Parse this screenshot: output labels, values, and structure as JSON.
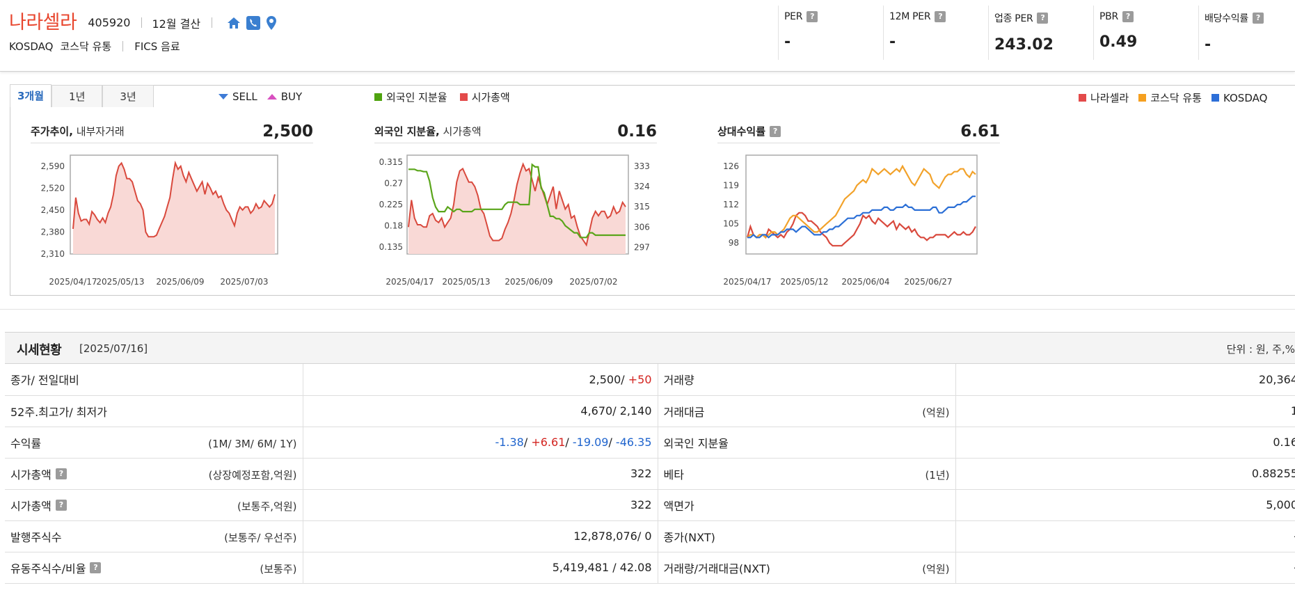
{
  "company": {
    "name": "나라셀라",
    "code": "405920",
    "fiscal": "12월 결산",
    "market": "KOSDAQ",
    "market_sector": "코스닥 유통",
    "fics": "FICS 음료",
    "icons": [
      "home-icon",
      "phone-icon",
      "location-pin-icon"
    ]
  },
  "metrics": [
    {
      "label": "PER",
      "value": "-"
    },
    {
      "label": "12M PER",
      "value": "-"
    },
    {
      "label": "업종 PER",
      "value": "243.02"
    },
    {
      "label": "PBR",
      "value": "0.49"
    },
    {
      "label": "배당수익률",
      "value": "-"
    }
  ],
  "tabs": [
    "3개월",
    "1년",
    "3년"
  ],
  "trade_legend": {
    "sell": "SELL",
    "buy": "BUY"
  },
  "mid_legend": [
    {
      "label": "외국인 지분율",
      "color": "#4fa30f"
    },
    {
      "label": "시가총액",
      "color": "#e34a4a"
    }
  ],
  "right_legend": [
    {
      "label": "나라셀라",
      "color": "#e34a4a"
    },
    {
      "label": "코스닥 유통",
      "color": "#f5a020"
    },
    {
      "label": "KOSDAQ",
      "color": "#2d6fd8"
    }
  ],
  "charts": {
    "price": {
      "title_bold": "주가추이,",
      "title_sub": "내부자거래",
      "value": "2,500"
    },
    "foreign": {
      "title_bold": "외국인 지분율,",
      "title_sub": "시가총액",
      "value": "0.16"
    },
    "relative": {
      "title_bold": "상대수익률",
      "value": "6.61"
    }
  },
  "chart_data": [
    {
      "type": "area",
      "title": "주가추이, 내부자거래",
      "x_ticks": [
        "2025/04/17",
        "2025/05/13",
        "2025/06/09",
        "2025/07/03"
      ],
      "y_ticks": [
        "2,310",
        "2,380",
        "2,450",
        "2,520",
        "2,590"
      ],
      "ylim": [
        2310,
        2625
      ],
      "series": [
        {
          "values": [
            2390,
            2490,
            2440,
            2415,
            2420,
            2420,
            2405,
            2445,
            2435,
            2420,
            2410,
            2425,
            2410,
            2440,
            2460,
            2500,
            2560,
            2590,
            2600,
            2580,
            2550,
            2550,
            2540,
            2510,
            2480,
            2470,
            2450,
            2380,
            2365,
            2365,
            2365,
            2370,
            2390,
            2410,
            2430,
            2460,
            2490,
            2550,
            2600,
            2580,
            2590,
            2560,
            2540,
            2570,
            2550,
            2530,
            2510,
            2525,
            2540,
            2500,
            2535,
            2520,
            2500,
            2510,
            2490,
            2495,
            2470,
            2450,
            2440,
            2420,
            2400,
            2440,
            2460,
            2450,
            2460,
            2460,
            2440,
            2450,
            2470,
            2455,
            2460,
            2480,
            2470,
            2460,
            2470,
            2500
          ]
        }
      ]
    },
    {
      "type": "line",
      "title": "외국인 지분율, 시가총액",
      "x_ticks": [
        "2025/04/17",
        "2025/05/13",
        "2025/06/09",
        "2025/07/02"
      ],
      "y_left_ticks": [
        "0.135",
        "0.18",
        "0.225",
        "0.27",
        "0.315"
      ],
      "y_right_ticks": [
        "297",
        "306",
        "315",
        "324",
        "333"
      ],
      "ylim_left": [
        0.12,
        0.33
      ],
      "ylim_right": [
        294,
        338
      ],
      "series": [
        {
          "name": "외국인 지분율",
          "axis": "left",
          "values": [
            0.3,
            0.3,
            0.3,
            0.297,
            0.297,
            0.295,
            0.295,
            0.275,
            0.24,
            0.22,
            0.21,
            0.21,
            0.21,
            0.22,
            0.215,
            0.21,
            0.215,
            0.215,
            0.21,
            0.21,
            0.21,
            0.21,
            0.215,
            0.215,
            0.215,
            0.215,
            0.215,
            0.215,
            0.215,
            0.215,
            0.215,
            0.215,
            0.225,
            0.23,
            0.23,
            0.23,
            0.23,
            0.225,
            0.225,
            0.225,
            0.225,
            0.31,
            0.305,
            0.305,
            0.26,
            0.25,
            0.225,
            0.2,
            0.2,
            0.195,
            0.195,
            0.19,
            0.18,
            0.175,
            0.17,
            0.165,
            0.165,
            0.155,
            0.155,
            0.155,
            0.165,
            0.165,
            0.16,
            0.16,
            0.16,
            0.16,
            0.16,
            0.16,
            0.16,
            0.16,
            0.16,
            0.16,
            0.16
          ]
        },
        {
          "name": "시가총액",
          "axis": "right",
          "values": [
            306,
            318,
            310,
            307,
            307,
            306,
            306,
            311,
            312,
            309,
            308,
            310,
            306,
            308,
            310,
            316,
            326,
            331,
            332,
            329,
            326,
            326,
            324,
            320,
            314,
            312,
            307,
            302,
            300,
            300,
            300,
            301,
            305,
            308,
            312,
            318,
            325,
            330,
            334,
            331,
            332,
            327,
            322,
            328,
            324,
            320,
            316,
            320,
            324,
            314,
            322,
            318,
            314,
            316,
            310,
            311,
            306,
            302,
            300,
            298,
            304,
            310,
            313,
            311,
            313,
            313,
            310,
            311,
            315,
            312,
            313,
            317,
            315
          ]
        }
      ]
    },
    {
      "type": "line",
      "title": "상대수익률",
      "x_ticks": [
        "2025/04/17",
        "2025/05/12",
        "2025/06/04",
        "2025/06/27"
      ],
      "y_ticks": [
        "98",
        "105",
        "112",
        "119",
        "126"
      ],
      "ylim": [
        94,
        130
      ],
      "series": [
        {
          "name": "나라셀라",
          "values": [
            100,
            104,
            101,
            100,
            101,
            101,
            100,
            103,
            102,
            101,
            100,
            101,
            100,
            102,
            103,
            105,
            108,
            109,
            109,
            108,
            106,
            106,
            105,
            104,
            102,
            101,
            100,
            98,
            97,
            97,
            97,
            97,
            98,
            99,
            100,
            101,
            103,
            105,
            108,
            107,
            108,
            106,
            105,
            107,
            106,
            105,
            104,
            105,
            106,
            103,
            105,
            104,
            103,
            104,
            102,
            103,
            101,
            100,
            100,
            99,
            100,
            100,
            101,
            101,
            101,
            101,
            100,
            101,
            102,
            101,
            101,
            102,
            101,
            101,
            102,
            104
          ]
        },
        {
          "name": "코스닥 유통",
          "values": [
            100,
            101,
            101,
            100,
            101,
            101,
            100,
            101,
            102,
            102,
            101,
            102,
            103,
            105,
            107,
            108,
            108,
            107,
            106,
            105,
            104,
            103,
            102,
            102,
            103,
            104,
            105,
            106,
            107,
            108,
            110,
            112,
            114,
            115,
            116,
            117,
            119,
            120,
            121,
            120,
            122,
            125,
            124,
            123,
            124,
            125,
            124,
            123,
            124,
            125,
            124,
            126,
            124,
            122,
            120,
            119,
            121,
            123,
            125,
            124,
            123,
            120,
            119,
            118,
            120,
            122,
            123,
            123,
            124,
            124,
            125,
            125,
            123,
            122,
            124,
            123
          ]
        },
        {
          "name": "KOSDAQ",
          "values": [
            100,
            100,
            101,
            100,
            100,
            101,
            101,
            100,
            101,
            101,
            101,
            102,
            102,
            103,
            103,
            103,
            102,
            103,
            104,
            104,
            103,
            102,
            101,
            101,
            101,
            102,
            102,
            103,
            103,
            104,
            104,
            105,
            106,
            107,
            107,
            107,
            108,
            108,
            109,
            109,
            109,
            110,
            110,
            110,
            110,
            111,
            111,
            110,
            110,
            111,
            111,
            111,
            112,
            111,
            111,
            110,
            110,
            110,
            110,
            110,
            110,
            111,
            111,
            109,
            109,
            110,
            111,
            111,
            111,
            112,
            112,
            113,
            113,
            114,
            115,
            115
          ]
        }
      ]
    }
  ],
  "price_status": {
    "title": "시세현황",
    "date": "[2025/07/16]",
    "unit": "단위 : 원, 주,%",
    "rows": [
      {
        "l_label": "종가/ 전일대비",
        "l_hint": "",
        "l_val": "2,500/",
        "l_val2": "+50",
        "r_label": "거래량",
        "r_hint": "",
        "r_val": "20,364"
      },
      {
        "l_label": "52주.최고가/ 최저가",
        "l_hint": "",
        "l_val": "4,670/ 2,140",
        "r_label": "거래대금",
        "r_hint": "(억원)",
        "r_val": "1"
      },
      {
        "l_label": "수익률",
        "l_hint": "(1M/ 3M/ 6M/ 1Y)",
        "ret": [
          "-1.38",
          "+6.61",
          "-19.09",
          "-46.35"
        ],
        "r_label": "외국인 지분율",
        "r_hint": "",
        "r_val": "0.16"
      },
      {
        "l_label": "시가총액",
        "l_hint": "(상장예정포함,억원)",
        "l_val": "322",
        "r_label": "베타",
        "r_hint": "(1년)",
        "r_val": "0.88255"
      },
      {
        "l_label": "시가총액",
        "l_hint": "(보통주,억원)",
        "l_val": "322",
        "r_label": "액면가",
        "r_hint": "",
        "r_val": "5,000"
      },
      {
        "l_label": "발행주식수",
        "l_hint": "(보통주/ 우선주)",
        "l_val": "12,878,076/ 0",
        "r_label": "종가(NXT)",
        "r_hint": "",
        "r_val": "-"
      },
      {
        "l_label": "유동주식수/비율",
        "l_hint": "(보통주)",
        "l_val": "5,419,481 / 42.08",
        "r_label": "거래량/거래대금(NXT)",
        "r_hint": "(억원)",
        "r_val": "-"
      }
    ]
  }
}
